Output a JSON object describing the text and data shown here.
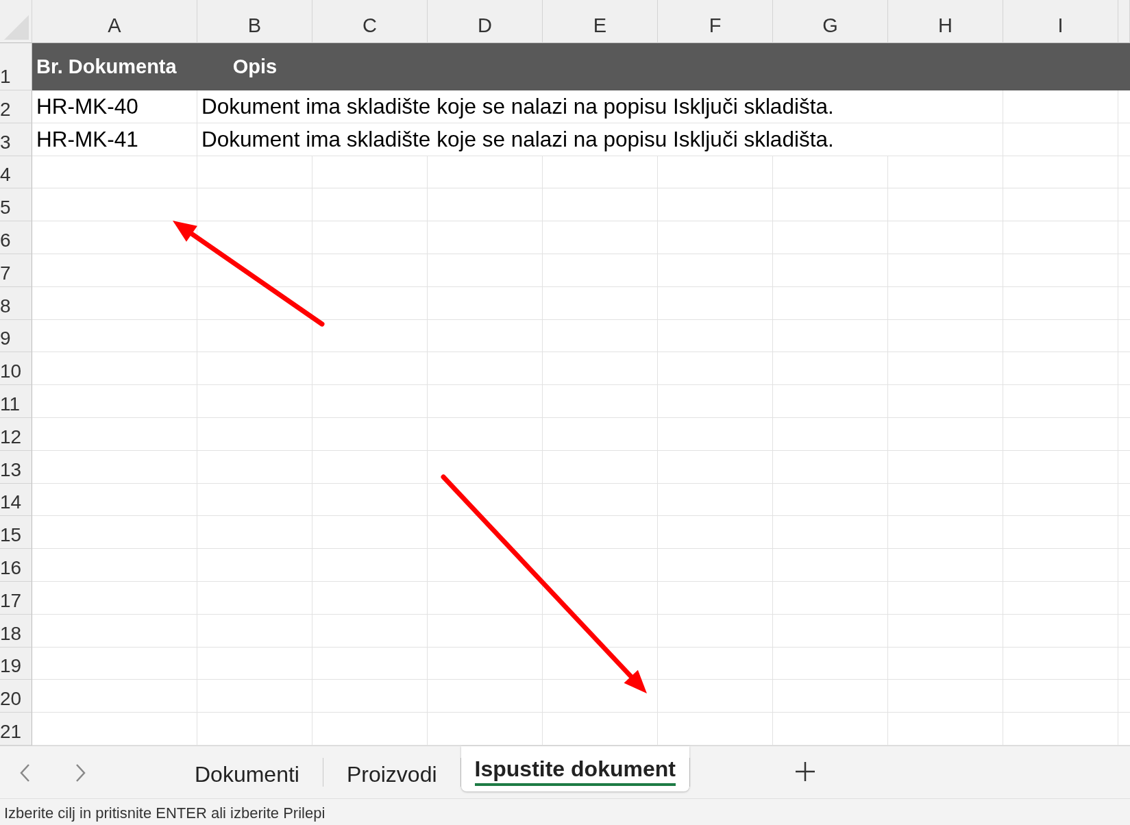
{
  "columns": [
    "A",
    "B",
    "C",
    "D",
    "E",
    "F",
    "G",
    "H",
    "I"
  ],
  "row_numbers": [
    "1",
    "2",
    "3",
    "4",
    "5",
    "6",
    "7",
    "8",
    "9",
    "10",
    "11",
    "12",
    "13",
    "14",
    "15",
    "16",
    "17",
    "18",
    "19",
    "20",
    "21"
  ],
  "header_row": [
    "Br. Dokumenta",
    "Opis"
  ],
  "rows": [
    [
      "HR-MK-40",
      "Dokument ima skladište koje se nalazi na popisu Isključi skladišta."
    ],
    [
      "HR-MK-41",
      "Dokument ima skladište koje se nalazi na popisu Isključi skladišta."
    ]
  ],
  "annotations": [
    {
      "kind": "arrow"
    },
    {
      "kind": "arrow"
    }
  ],
  "sheet_tabs": [
    {
      "label": "Dokumenti",
      "selected": false
    },
    {
      "label": "Proizvodi",
      "selected": false
    },
    {
      "label": "Ispustite dokument",
      "selected": true
    }
  ],
  "status_bar": "Izberite cilj in pritisnite ENTER ali izberite Prilepi"
}
